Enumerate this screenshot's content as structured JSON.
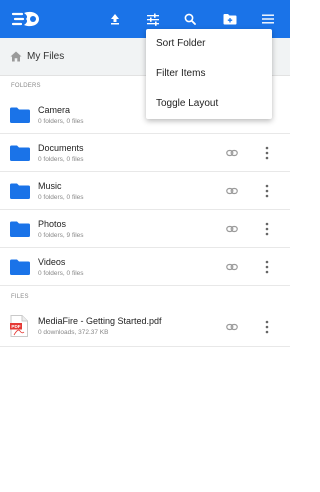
{
  "appbar": {
    "logo": "mediafire-logo",
    "actions": [
      "upload-icon",
      "filter-sliders-icon",
      "search-icon",
      "new-folder-icon",
      "hamburger-menu-icon"
    ],
    "color": "#1a73e8"
  },
  "breadcrumb": {
    "title": "My Files"
  },
  "sections": {
    "folders": "FOLDERS",
    "files": "FILES"
  },
  "folders": [
    {
      "name": "Camera",
      "meta": "0 folders, 0 files"
    },
    {
      "name": "Documents",
      "meta": "0 folders, 0 files"
    },
    {
      "name": "Music",
      "meta": "0 folders, 0 files"
    },
    {
      "name": "Photos",
      "meta": "0 folders, 9 files"
    },
    {
      "name": "Videos",
      "meta": "0 folders, 0 files"
    }
  ],
  "files": [
    {
      "name": "MediaFire - Getting Started.pdf",
      "meta": "0 downloads, 372.37 KB",
      "icon_label": "PDF"
    }
  ],
  "menu": {
    "items": [
      "Sort Folder",
      "Filter Items",
      "Toggle Layout"
    ]
  },
  "colors": {
    "folder": "#1a73e8",
    "pdf": "#e53935"
  }
}
